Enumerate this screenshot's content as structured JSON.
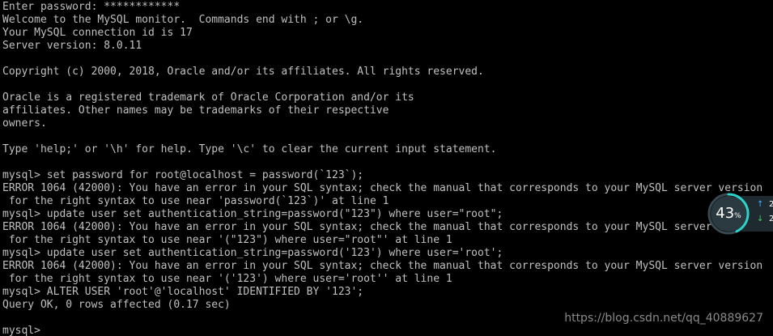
{
  "terminal": {
    "lines": [
      "Enter password: ************",
      "Welcome to the MySQL monitor.  Commands end with ; or \\g.",
      "Your MySQL connection id is 17",
      "Server version: 8.0.11",
      "",
      "Copyright (c) 2000, 2018, Oracle and/or its affiliates. All rights reserved.",
      "",
      "Oracle is a registered trademark of Oracle Corporation and/or its",
      "affiliates. Other names may be trademarks of their respective",
      "owners.",
      "",
      "Type 'help;' or '\\h' for help. Type '\\c' to clear the current input statement.",
      "",
      "mysql> set password for root@localhost = password(`123`);",
      "ERROR 1064 (42000): You have an error in your SQL syntax; check the manual that corresponds to your MySQL server version",
      " for the right syntax to use near 'password(`123`)' at line 1",
      "mysql> update user set authentication_string=password(\"123\") where user=\"root\";",
      "ERROR 1064 (42000): You have an error in your SQL syntax; check the manual that corresponds to your MySQL server version",
      " for the right syntax to use near '(\"123\") where user=\"root\"' at line 1",
      "mysql> update user set authentication_string=password('123') where user='root';",
      "ERROR 1064 (42000): You have an error in your SQL syntax; check the manual that corresponds to your MySQL server version",
      " for the right syntax to use near '('123') where user='root'' at line 1",
      "mysql> ALTER USER 'root'@'localhost' IDENTIFIED BY '123';",
      "Query OK, 0 rows affected (0.17 sec)",
      "",
      "mysql>"
    ]
  },
  "watermark": {
    "text": "https://blog.csdn.net/qq_40889627"
  },
  "speed_widget": {
    "percent": "43",
    "percent_unit": "%",
    "percent_value": 43,
    "up_value": "2",
    "down_value": "2",
    "ring_color": "#2fd2c8"
  },
  "colors": {
    "background": "#000000",
    "text": "#c0c0c0",
    "watermark": "#8a8a8a"
  }
}
